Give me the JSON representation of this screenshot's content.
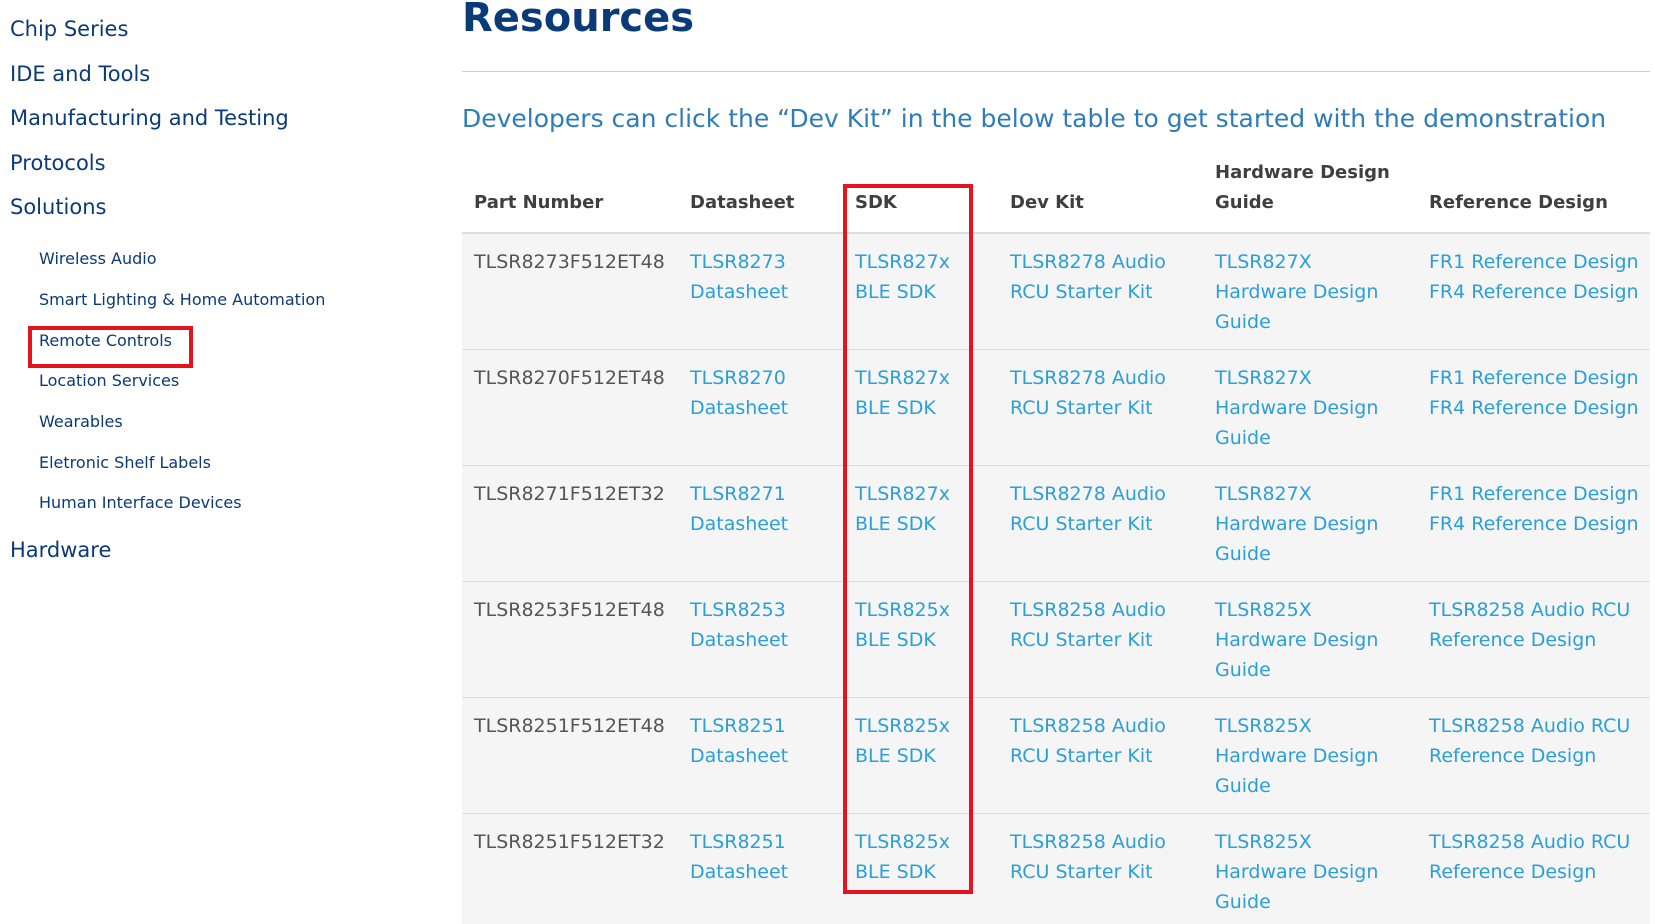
{
  "sidebar": {
    "top_items": [
      "Chip Series",
      "IDE and Tools",
      "Manufacturing and Testing",
      "Protocols",
      "Solutions"
    ],
    "solutions_sub_items": [
      "Wireless Audio",
      "Smart Lighting & Home Automation",
      "Remote Controls",
      "Location Services",
      "Wearables",
      "Eletronic Shelf Labels",
      "Human Interface Devices"
    ],
    "bottom_item": "Hardware",
    "highlighted_item": "Remote Controls"
  },
  "main": {
    "title": "Resources",
    "intro": "Developers can click the “Dev Kit” in the below table to get started with the demonstration",
    "table": {
      "headers": {
        "part_number": "Part Number",
        "datasheet": "Datasheet",
        "sdk": "SDK",
        "dev_kit": "Dev Kit",
        "hw_guide_line1": "Hardware Design",
        "hw_guide_line2": "Guide",
        "reference_design": "Reference Design"
      },
      "rows": [
        {
          "part": "TLSR8273F512ET48",
          "datasheet": [
            "TLSR8273",
            "Datasheet"
          ],
          "sdk": [
            "TLSR827x",
            "BLE SDK"
          ],
          "devkit": [
            "TLSR8278 Audio",
            "RCU Starter Kit"
          ],
          "hwguide": [
            "TLSR827X",
            "Hardware Design",
            "Guide"
          ],
          "refdesign": [
            "FR1 Reference Design",
            "FR4 Reference Design"
          ]
        },
        {
          "part": "TLSR8270F512ET48",
          "datasheet": [
            "TLSR8270",
            "Datasheet"
          ],
          "sdk": [
            "TLSR827x",
            "BLE SDK"
          ],
          "devkit": [
            "TLSR8278 Audio",
            "RCU Starter Kit"
          ],
          "hwguide": [
            "TLSR827X",
            "Hardware Design",
            "Guide"
          ],
          "refdesign": [
            "FR1 Reference Design",
            "FR4 Reference Design"
          ]
        },
        {
          "part": "TLSR8271F512ET32",
          "datasheet": [
            "TLSR8271",
            "Datasheet"
          ],
          "sdk": [
            "TLSR827x",
            "BLE SDK"
          ],
          "devkit": [
            "TLSR8278 Audio",
            "RCU Starter Kit"
          ],
          "hwguide": [
            "TLSR827X",
            "Hardware Design",
            "Guide"
          ],
          "refdesign": [
            "FR1 Reference Design",
            "FR4 Reference Design"
          ]
        },
        {
          "part": "TLSR8253F512ET48",
          "datasheet": [
            "TLSR8253",
            "Datasheet"
          ],
          "sdk": [
            "TLSR825x",
            "BLE SDK"
          ],
          "devkit": [
            "TLSR8258 Audio",
            "RCU Starter Kit"
          ],
          "hwguide": [
            "TLSR825X",
            "Hardware Design",
            "Guide"
          ],
          "refdesign": [
            "TLSR8258 Audio RCU",
            "Reference Design"
          ]
        },
        {
          "part": "TLSR8251F512ET48",
          "datasheet": [
            "TLSR8251",
            "Datasheet"
          ],
          "sdk": [
            "TLSR825x",
            "BLE SDK"
          ],
          "devkit": [
            "TLSR8258 Audio",
            "RCU Starter Kit"
          ],
          "hwguide": [
            "TLSR825X",
            "Hardware Design",
            "Guide"
          ],
          "refdesign": [
            "TLSR8258 Audio RCU",
            "Reference Design"
          ]
        },
        {
          "part": "TLSR8251F512ET32",
          "datasheet": [
            "TLSR8251",
            "Datasheet"
          ],
          "sdk": [
            "TLSR825x",
            "BLE SDK"
          ],
          "devkit": [
            "TLSR8258 Audio",
            "RCU Starter Kit"
          ],
          "hwguide": [
            "TLSR825X",
            "Hardware Design",
            "Guide"
          ],
          "refdesign": [
            "TLSR8258 Audio RCU",
            "Reference Design"
          ]
        }
      ]
    }
  },
  "colors": {
    "nav_text": "#0a3a78",
    "title": "#0a3a78",
    "intro": "#2e7cb8",
    "link": "#2a9fd8",
    "annotation_red": "#e3141e",
    "row_bg": "#f5f5f5"
  }
}
